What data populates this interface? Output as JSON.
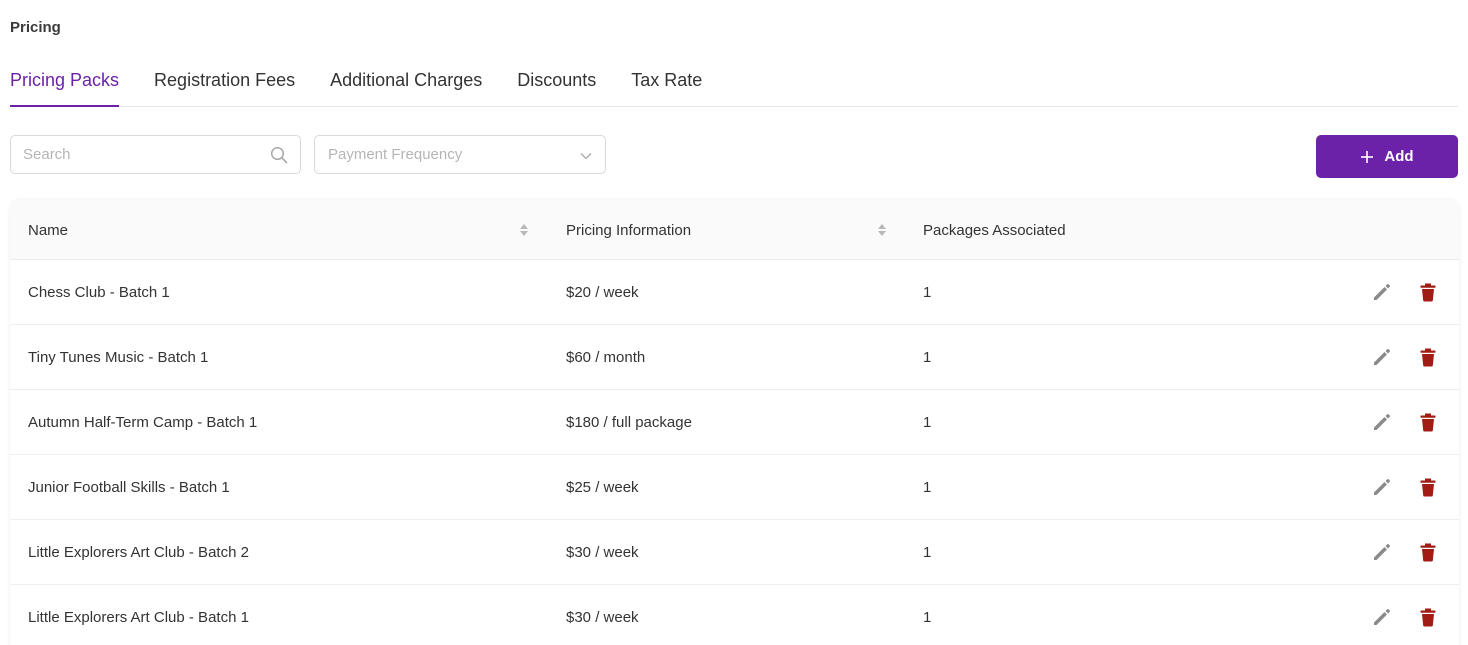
{
  "page": {
    "title": "Pricing"
  },
  "tabs": [
    {
      "label": "Pricing Packs",
      "active": true
    },
    {
      "label": "Registration Fees",
      "active": false
    },
    {
      "label": "Additional Charges",
      "active": false
    },
    {
      "label": "Discounts",
      "active": false
    },
    {
      "label": "Tax Rate",
      "active": false
    }
  ],
  "toolbar": {
    "search_placeholder": "Search",
    "search_value": "",
    "frequency_placeholder": "Payment Frequency",
    "add_label": "Add",
    "accent_color": "#6b21a8"
  },
  "table": {
    "columns": {
      "name": "Name",
      "pricing": "Pricing Information",
      "packages": "Packages Associated"
    },
    "rows": [
      {
        "name": "Chess Club - Batch 1",
        "pricing": "$20 / week",
        "packages": "1"
      },
      {
        "name": "Tiny Tunes Music - Batch 1",
        "pricing": "$60 / month",
        "packages": "1"
      },
      {
        "name": "Autumn Half-Term Camp - Batch 1",
        "pricing": "$180 / full package",
        "packages": "1"
      },
      {
        "name": "Junior Football Skills - Batch 1",
        "pricing": "$25 / week",
        "packages": "1"
      },
      {
        "name": "Little Explorers Art Club - Batch 2",
        "pricing": "$30 / week",
        "packages": "1"
      },
      {
        "name": "Little Explorers Art Club - Batch 1",
        "pricing": "$30 / week",
        "packages": "1"
      }
    ],
    "icons": {
      "edit": "pencil-icon",
      "delete": "trash-icon",
      "edit_color": "#8a8a8a",
      "delete_color": "#a01c14"
    }
  }
}
